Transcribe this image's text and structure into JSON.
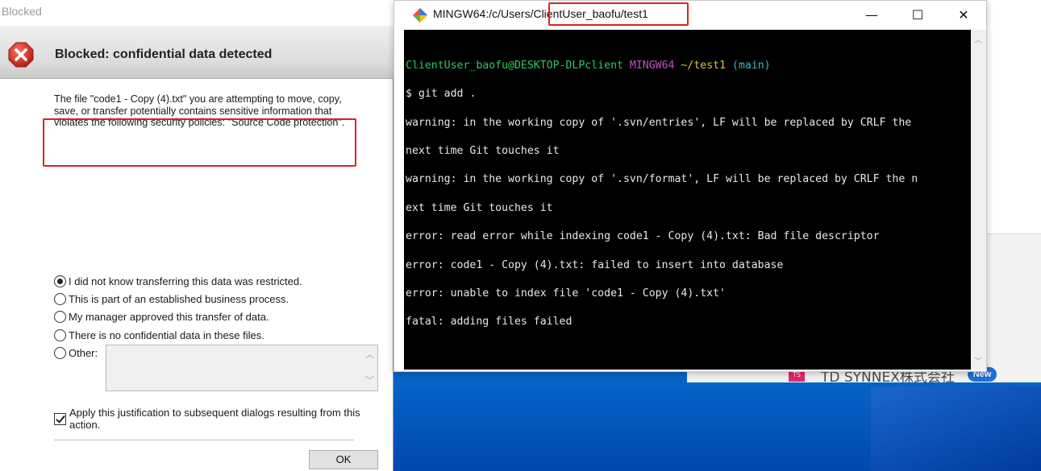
{
  "dialog": {
    "window_title": "Blocked",
    "header": "Blocked: confidential data detected",
    "message": "The file \"code1 - Copy (4).txt\" you are attempting to move, copy, save, or transfer potentially contains sensitive information that violates the following security policies: \"Source Code protection\".",
    "options": [
      {
        "label": "I did not know transferring this data was restricted.",
        "selected": true
      },
      {
        "label": "This is part of an established business process.",
        "selected": false
      },
      {
        "label": "My manager approved this transfer of data.",
        "selected": false
      },
      {
        "label": "There is no confidential data in these files.",
        "selected": false
      },
      {
        "label": "Other:",
        "selected": false
      }
    ],
    "other_value": "",
    "apply_label": "Apply this justification to subsequent dialogs resulting from this action.",
    "apply_checked": true,
    "ok_label": "OK",
    "icon": "error-x-icon",
    "highlight_color": "#e02020"
  },
  "terminal": {
    "title": "MINGW64:/c/Users/ClientUser_baofu/test1",
    "minimize_label": "—",
    "maximize_label": "☐",
    "close_label": "✕",
    "prompt": {
      "user_host": "ClientUser_baofu@DESKTOP-DLPclient",
      "shell": "MINGW64",
      "path": "~/test1",
      "branch": "(main)"
    },
    "command": "$ git add .",
    "output": [
      "warning: in the working copy of '.svn/entries', LF will be replaced by CRLF the",
      "next time Git touches it",
      "warning: in the working copy of '.svn/format', LF will be replaced by CRLF the n",
      "ext time Git touches it",
      "error: read error while indexing code1 - Copy (4).txt: Bad file descriptor",
      "error: code1 - Copy (4).txt: failed to insert into database",
      "error: unable to index file 'code1 - Copy (4).txt'",
      "fatal: adding files failed"
    ],
    "final_prompt": "$",
    "colors": {
      "user": "#31c75f",
      "shell": "#c252c8",
      "path": "#d6c742",
      "branch": "#33bcc8"
    }
  },
  "background": {
    "badge": "TS",
    "company": "TD SYNNEX株式会社",
    "new_badge": "New"
  }
}
